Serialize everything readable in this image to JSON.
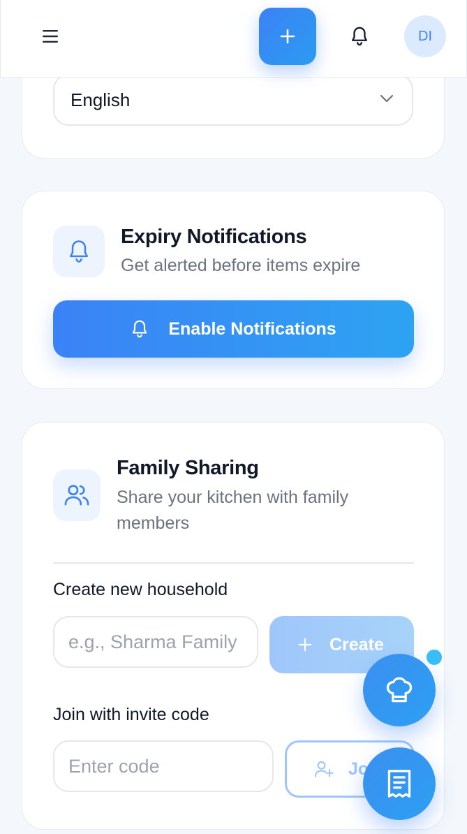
{
  "header": {
    "menu_icon": "hamburger-menu-icon",
    "add_icon": "plus-icon",
    "bell_icon": "bell-icon",
    "avatar_initials": "DI"
  },
  "language": {
    "selected": "English"
  },
  "expiry": {
    "title": "Expiry Notifications",
    "subtitle": "Get alerted before items expire",
    "button_label": "Enable Notifications"
  },
  "family": {
    "title": "Family Sharing",
    "subtitle": "Share your kitchen with family members",
    "create_label": "Create new household",
    "household_placeholder": "e.g., Sharma Family",
    "create_button": "Create",
    "join_label": "Join with invite code",
    "code_placeholder": "Enter code",
    "join_button": "Join"
  },
  "colors": {
    "accent": "#3b82f6",
    "accent_light": "#9fc6fa",
    "badge": "#38bdf8"
  },
  "fabs": {
    "chef_icon": "chef-hat-icon",
    "list_icon": "receipt-list-icon"
  }
}
